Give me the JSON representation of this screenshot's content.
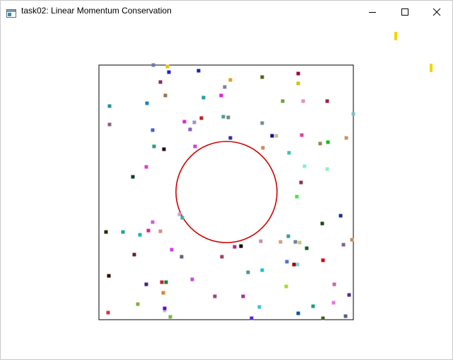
{
  "window": {
    "title": "task02: Linear Momentum Conservation",
    "icon": "app-window-icon",
    "controls": [
      "minimize-icon",
      "maximize-icon",
      "close-icon"
    ]
  },
  "simulation": {
    "container": "square-box",
    "obstacle": "circle",
    "circle_color": "#d00000",
    "box_color": "#000000",
    "marker_color": "#f2d600",
    "particles": [
      {
        "c": "#6a7fb0"
      },
      {
        "c": "#f0c000"
      },
      {
        "c": "#2020d0"
      },
      {
        "c": "#2020a0"
      },
      {
        "c": "#803060"
      },
      {
        "c": "#e0a020"
      },
      {
        "c": "#506020"
      },
      {
        "c": "#a00030"
      },
      {
        "c": "#d0c000"
      },
      {
        "c": "#8080a0"
      },
      {
        "c": "#a07050"
      },
      {
        "c": "#20a0a0"
      },
      {
        "c": "#e020e0"
      },
      {
        "c": "#70a040"
      },
      {
        "c": "#e090c0"
      },
      {
        "c": "#a02040"
      },
      {
        "c": "#2090a0"
      },
      {
        "c": "#2080c0"
      },
      {
        "c": "#d030d0"
      },
      {
        "c": "#a090d0"
      },
      {
        "c": "#c02020"
      },
      {
        "c": "#40a0a0"
      },
      {
        "c": "#808080"
      },
      {
        "c": "#709090"
      },
      {
        "c": "#906080"
      },
      {
        "c": "#8060c0"
      },
      {
        "c": "#4060d0"
      },
      {
        "c": "#101080"
      },
      {
        "c": "#c0c0a0"
      },
      {
        "c": "#d09060"
      },
      {
        "c": "#e040a0"
      },
      {
        "c": "#3030a0"
      },
      {
        "c": "#c09060"
      },
      {
        "c": "#20a080"
      },
      {
        "c": "#200020"
      },
      {
        "c": "#d040d0"
      },
      {
        "c": "#40c0c0"
      },
      {
        "c": "#a08050"
      },
      {
        "c": "#10c010"
      },
      {
        "c": "#80f0d0"
      },
      {
        "c": "#e040c0"
      },
      {
        "c": "#90f0c0"
      },
      {
        "c": "#104020"
      },
      {
        "c": "#903050"
      },
      {
        "c": "#50e050"
      },
      {
        "c": "#203080"
      },
      {
        "c": "#105010"
      },
      {
        "c": "#80c0c0"
      },
      {
        "c": "#d0a0d0"
      },
      {
        "c": "#40b0a0"
      },
      {
        "c": "#203000"
      },
      {
        "c": "#20a0a0"
      },
      {
        "c": "#d060d0"
      },
      {
        "c": "#d09080"
      },
      {
        "c": "#e020a0"
      },
      {
        "c": "#20b0b0"
      },
      {
        "c": "#30a0a0"
      },
      {
        "c": "#708090"
      },
      {
        "c": "#d0a080"
      },
      {
        "c": "#c090b0"
      },
      {
        "c": "#d0c080"
      },
      {
        "c": "#806090"
      },
      {
        "c": "#c09060"
      },
      {
        "c": "#a03080"
      },
      {
        "c": "#000000"
      },
      {
        "c": "#106030"
      },
      {
        "c": "#d040e0"
      },
      {
        "c": "#602030"
      },
      {
        "c": "#606080"
      },
      {
        "c": "#a04060"
      },
      {
        "c": "#5090a0"
      },
      {
        "c": "#20c0c0"
      },
      {
        "c": "#80d0e0"
      },
      {
        "c": "#5070d0"
      },
      {
        "c": "#a00000"
      },
      {
        "c": "#d00010"
      },
      {
        "c": "#300000"
      },
      {
        "c": "#c050d0"
      },
      {
        "c": "#402080"
      },
      {
        "c": "#c02040"
      },
      {
        "c": "#208020"
      },
      {
        "c": "#a0e020"
      },
      {
        "c": "#d060b0"
      },
      {
        "c": "#e08030"
      },
      {
        "c": "#a04080"
      },
      {
        "c": "#a030a0"
      },
      {
        "c": "#503080"
      },
      {
        "c": "#f070e0"
      },
      {
        "c": "#80b040"
      },
      {
        "c": "#10a080"
      },
      {
        "c": "#40c0e0"
      },
      {
        "c": "#a0d0d0"
      },
      {
        "c": "#1050a0"
      },
      {
        "c": "#d03050"
      },
      {
        "c": "#80b050"
      },
      {
        "c": "#6020d0"
      },
      {
        "c": "#406020"
      },
      {
        "c": "#506080"
      },
      {
        "c": "#7000d0"
      },
      {
        "c": "#305070"
      },
      {
        "c": "#2040a0"
      }
    ]
  }
}
